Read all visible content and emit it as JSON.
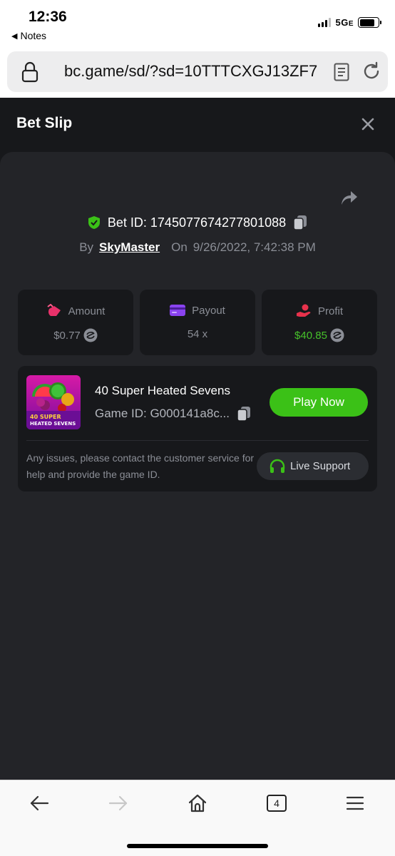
{
  "status_bar": {
    "time": "12:36",
    "back_label": "Notes",
    "network": "5G",
    "network_sub": "E"
  },
  "browser": {
    "url": "bc.game/sd/?sd=10TTTCXGJ13ZF7",
    "tabs_count": "4"
  },
  "bet_slip": {
    "title": "Bet Slip",
    "bet_id_prefix": "Bet ID: ",
    "bet_id": "1745077674277801088",
    "by_label": "By",
    "user": "SkyMaster",
    "on_label": "On",
    "datetime": "9/26/2022, 7:42:38 PM",
    "stats": [
      {
        "label": "Amount",
        "value": "$0.77",
        "icon": "money-bag-icon"
      },
      {
        "label": "Payout",
        "value": "54 x",
        "icon": "card-icon"
      },
      {
        "label": "Profit",
        "value": "$40.85",
        "icon": "hand-coin-icon"
      }
    ],
    "game": {
      "title": "40 Super Heated Sevens",
      "id_label": "Game ID: G000141a8c...",
      "thumb_line1": "40 SUPER",
      "thumb_line2": "HEATED SEVENS",
      "play_label": "Play Now"
    },
    "support": {
      "text": "Any issues, please contact the customer service for help and provide the game ID.",
      "button_label": "Live Support"
    }
  },
  "colors": {
    "accent_green": "#3bc117",
    "profit_green": "#46c12a",
    "panel_bg": "#232428",
    "sheet_bg": "#17181b"
  }
}
